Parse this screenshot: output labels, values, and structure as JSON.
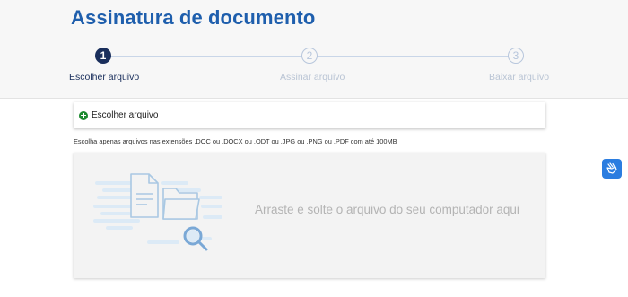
{
  "header": {
    "title": "Assinatura de documento"
  },
  "stepper": {
    "steps": [
      {
        "number": "1",
        "label": "Escolher arquivo",
        "state": "active"
      },
      {
        "number": "2",
        "label": "Assinar arquivo",
        "state": "inactive"
      },
      {
        "number": "3",
        "label": "Baixar arquivo",
        "state": "inactive"
      }
    ]
  },
  "upload": {
    "choose_label": "Escolher arquivo",
    "hint": "Escolha apenas arquivos nas extensões .DOC ou .DOCX ou .ODT ou .JPG ou .PNG ou .PDF com até 100MB",
    "dropzone_text": "Arraste e solte o arquivo do seu computador aqui"
  },
  "icons": {
    "plus": "plus-circle-icon",
    "illustration": "documents-search-illustration",
    "accessibility": "sign-language-icon"
  },
  "colors": {
    "title": "#1f5fad",
    "step_active": "#1a2f5c",
    "step_inactive": "#b7c6dc",
    "plus_green": "#1b8a2e",
    "accessibility_blue": "#2b7de0"
  }
}
